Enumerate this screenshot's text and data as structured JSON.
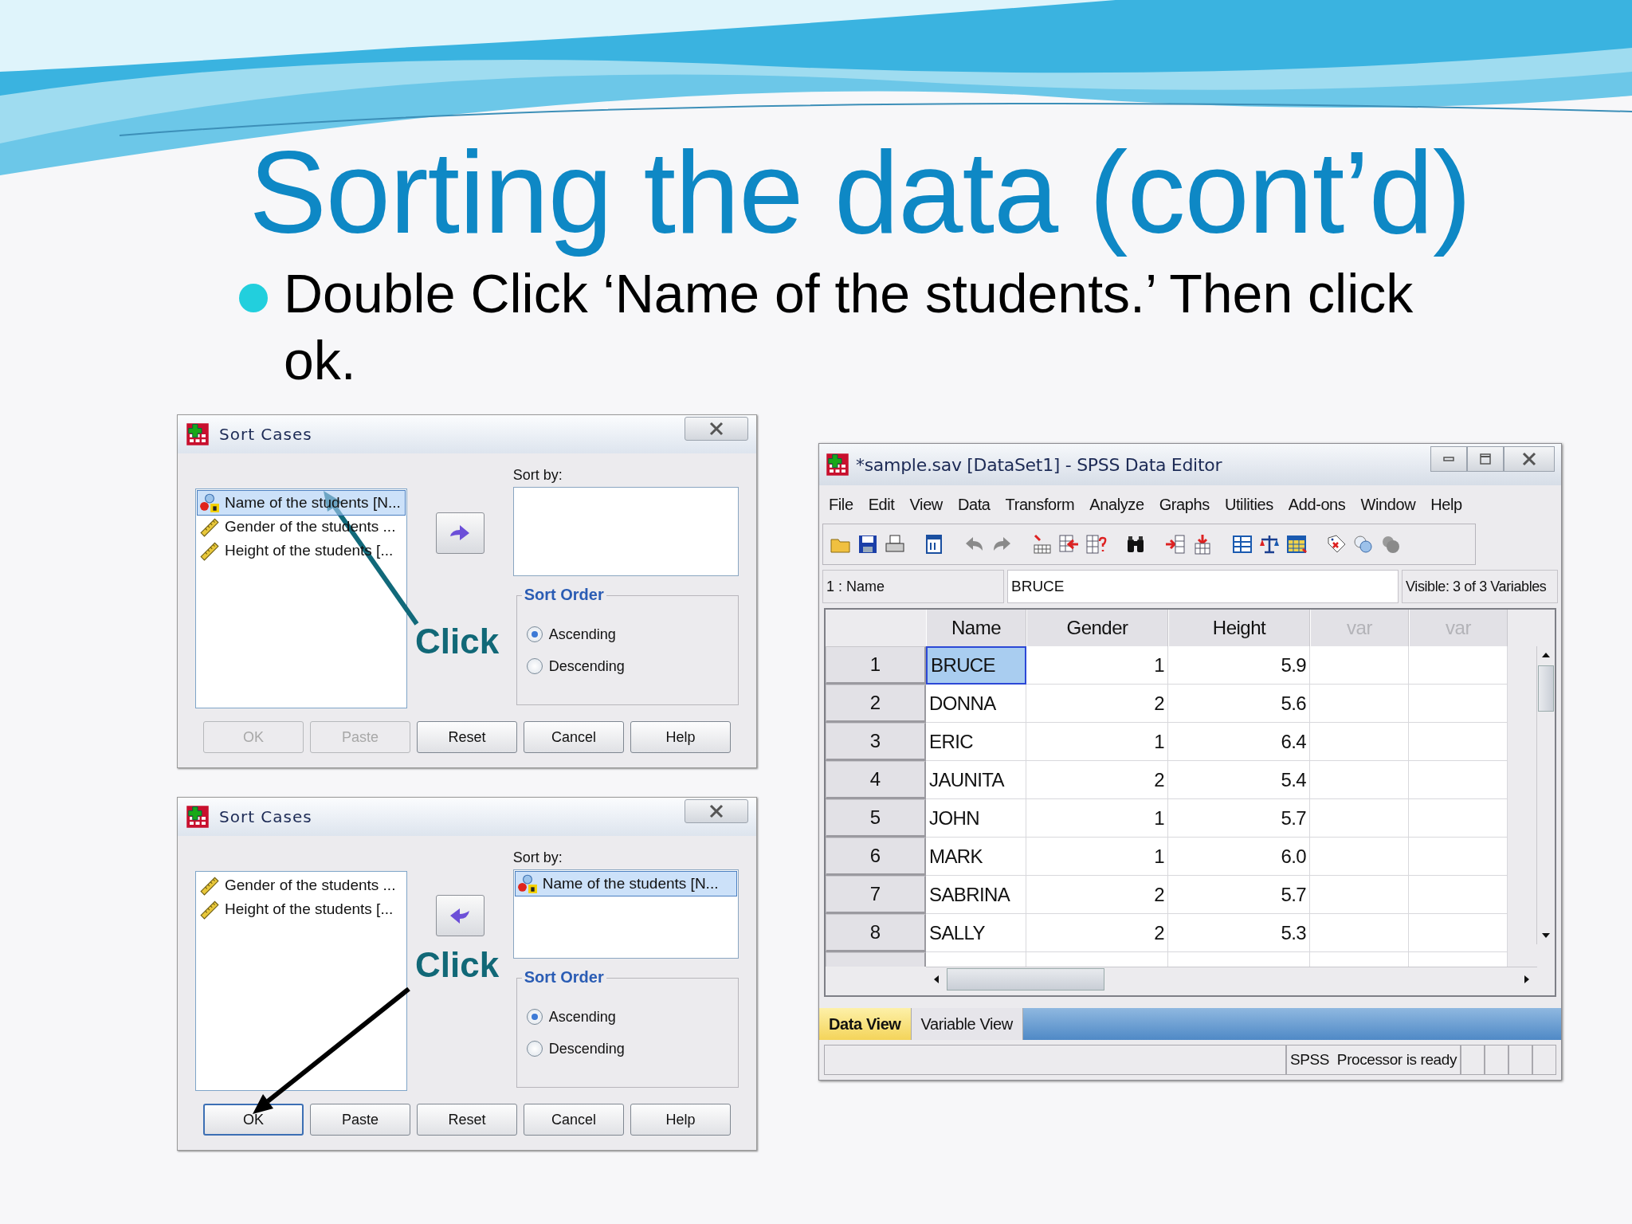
{
  "slide": {
    "title": "Sorting the data (cont’d)",
    "bullets": [
      {
        "text": "Double Click ‘Name of the students.’ Then click ok."
      }
    ]
  },
  "dialogs": [
    {
      "title": "Sort Cases",
      "variables": [
        {
          "label": "Name of the students [N...",
          "kind": "string",
          "selected": true
        },
        {
          "label": "Gender of the students ...",
          "kind": "scale",
          "selected": false
        },
        {
          "label": "Height of the students [...",
          "kind": "scale",
          "selected": false
        }
      ],
      "move_button": {
        "kind": "right"
      },
      "sort_by_label": "Sort by:",
      "sort_order": {
        "legend": "Sort Order",
        "options": [
          {
            "label": "Ascending",
            "selected": true
          },
          {
            "label": "Descending",
            "selected": false
          }
        ]
      },
      "buttons": [
        {
          "label": "OK",
          "disabled": true,
          "default": false
        },
        {
          "label": "Paste",
          "disabled": true,
          "default": false
        },
        {
          "label": "Reset",
          "disabled": false,
          "default": false
        },
        {
          "label": "Cancel",
          "disabled": false,
          "default": false
        },
        {
          "label": "Help",
          "disabled": false,
          "default": false
        }
      ],
      "annotation": {
        "label": "Click",
        "kind": "variable"
      }
    },
    {
      "title": "Sort Cases",
      "variables": [
        {
          "label": "Gender of the students ...",
          "kind": "scale",
          "selected": false
        },
        {
          "label": "Height of the students [...",
          "kind": "scale",
          "selected": false
        }
      ],
      "move_button": {
        "kind": "left"
      },
      "sort_by_label": "Sort by:",
      "sort_by": [
        {
          "label": "Name of the students [N...",
          "kind": "string",
          "selected": true
        }
      ],
      "sort_order": {
        "legend": "Sort Order",
        "options": [
          {
            "label": "Ascending",
            "selected": true
          },
          {
            "label": "Descending",
            "selected": false
          }
        ]
      },
      "buttons": [
        {
          "label": "OK",
          "disabled": false,
          "default": true
        },
        {
          "label": "Paste",
          "disabled": false,
          "default": false
        },
        {
          "label": "Reset",
          "disabled": false,
          "default": false
        },
        {
          "label": "Cancel",
          "disabled": false,
          "default": false
        },
        {
          "label": "Help",
          "disabled": false,
          "default": false
        }
      ],
      "annotation": {
        "label": "Click",
        "kind": "ok-button"
      }
    }
  ],
  "editor": {
    "title": "*sample.sav [DataSet1] - SPSS Data Editor",
    "menu": [
      "File",
      "Edit",
      "View",
      "Data",
      "Transform",
      "Analyze",
      "Graphs",
      "Utilities",
      "Add-ons",
      "Window",
      "Help"
    ],
    "cell_ref": "1 : Name",
    "cell_value": "BRUCE",
    "visible": "Visible: 3 of 3 Variables",
    "columns": [
      {
        "label": "Name",
        "kind": "variable"
      },
      {
        "label": "Gender",
        "kind": "variable"
      },
      {
        "label": "Height",
        "kind": "variable"
      },
      {
        "label": "var",
        "kind": "empty"
      },
      {
        "label": "var",
        "kind": "empty"
      }
    ],
    "rows": [
      {
        "number": "1",
        "cells": [
          "BRUCE",
          "1",
          "5.9"
        ],
        "selected": true
      },
      {
        "number": "2",
        "cells": [
          "DONNA",
          "2",
          "5.6"
        ],
        "selected": false
      },
      {
        "number": "3",
        "cells": [
          "ERIC",
          "1",
          "6.4"
        ],
        "selected": false
      },
      {
        "number": "4",
        "cells": [
          "JAUNITA",
          "2",
          "5.4"
        ],
        "selected": false
      },
      {
        "number": "5",
        "cells": [
          "JOHN",
          "1",
          "5.7"
        ],
        "selected": false
      },
      {
        "number": "6",
        "cells": [
          "MARK",
          "1",
          "6.0"
        ],
        "selected": false
      },
      {
        "number": "7",
        "cells": [
          "SABRINA",
          "2",
          "5.7"
        ],
        "selected": false
      },
      {
        "number": "8",
        "cells": [
          "SALLY",
          "2",
          "5.3"
        ],
        "selected": false
      }
    ],
    "tabs": [
      {
        "label": "Data View",
        "selected": true
      },
      {
        "label": "Variable View",
        "selected": false
      }
    ],
    "status": "SPSS  Processor is ready"
  }
}
